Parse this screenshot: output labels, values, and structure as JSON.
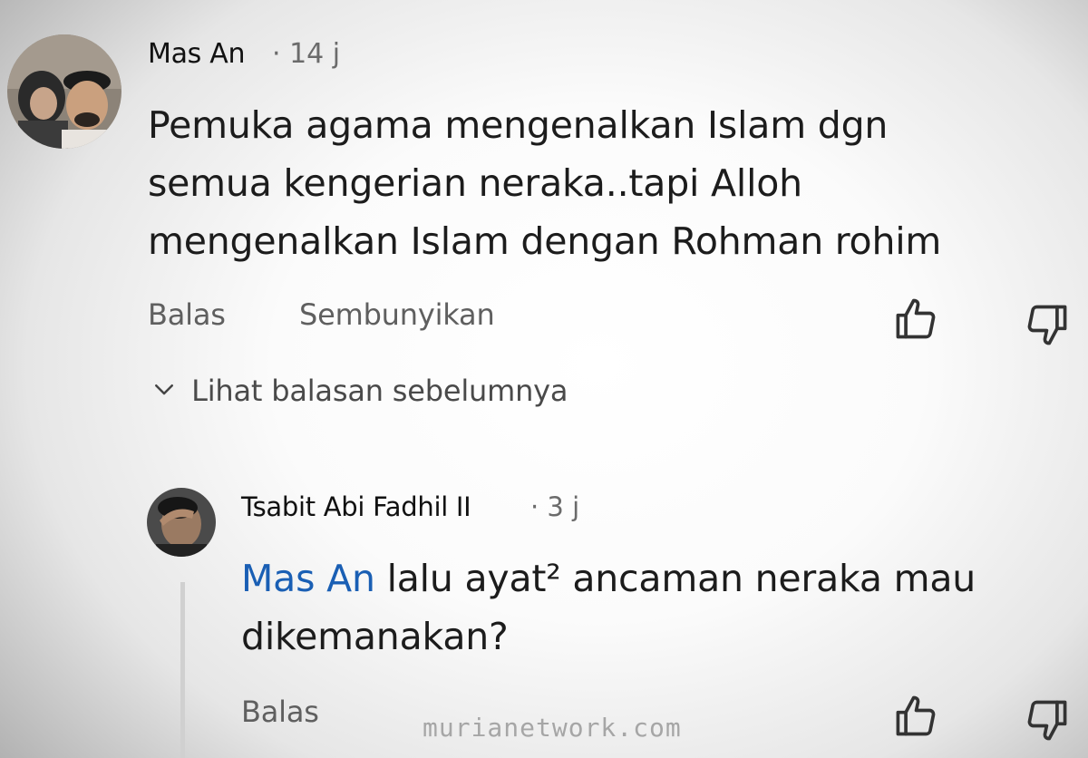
{
  "comment": {
    "author": "Mas An",
    "time": "· 14 j",
    "text_lines": [
      "Pemuka agama mengenalkan Islam dgn",
      "semua kengerian neraka..tapi Alloh",
      "mengenalkan Islam dengan Rohman rohim"
    ],
    "reply_label": "Balas",
    "hide_label": "Sembunyikan"
  },
  "view_previous": {
    "label": "Lihat balasan sebelumnya",
    "icon": "chevron-down-icon"
  },
  "reply": {
    "author": "Tsabit Abi Fadhil II",
    "time": "· 3 j",
    "mention": "Mas An",
    "text_line1": " lalu ayat² ancaman neraka mau",
    "text_line2": "dikemanakan?",
    "reply_label": "Balas"
  },
  "icons": {
    "like": "thumbs-up-icon",
    "dislike": "thumbs-down-icon"
  },
  "watermark": "murianetwork.com"
}
